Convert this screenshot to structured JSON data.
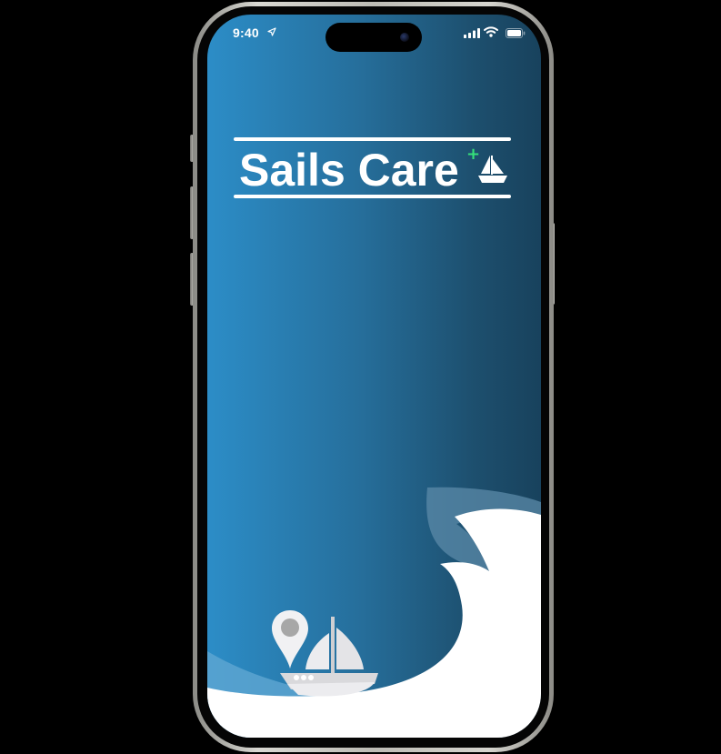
{
  "status_bar": {
    "time": "9:40",
    "icons": [
      "location-arrow-icon",
      "signal-icon",
      "wifi-icon",
      "battery-icon"
    ]
  },
  "logo": {
    "text": "Sails Care",
    "plus_symbol": "+",
    "icon": "sailboat-icon"
  },
  "illustration": {
    "icons": [
      "location-pin-icon",
      "sailboat-icon"
    ]
  },
  "colors": {
    "gradient_start": "#2c8dc7",
    "gradient_end": "#18425d",
    "plus_accent": "#35e07a",
    "wave": "#ffffff"
  }
}
